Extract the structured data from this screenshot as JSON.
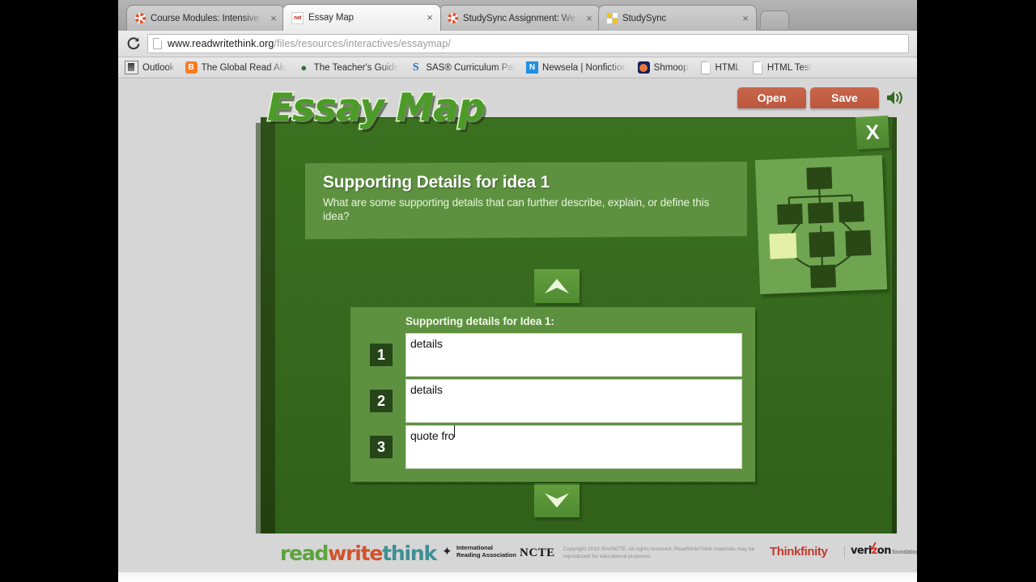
{
  "browser": {
    "tabs": [
      {
        "title": "Course Modules: Intensive",
        "favicon": "ring-icon",
        "active": false,
        "close": "×"
      },
      {
        "title": "Essay Map",
        "favicon": "rwt-icon",
        "active": true,
        "close": "×"
      },
      {
        "title": "StudySync Assignment: We",
        "favicon": "ring-icon",
        "active": false,
        "close": "×"
      },
      {
        "title": "StudySync",
        "favicon": "grid-icon",
        "active": false,
        "close": "×"
      }
    ],
    "reload_glyph": "⟳",
    "url": {
      "domain": "www.readwritethink.org",
      "path": "/files/resources/interactives/essaymap/"
    },
    "bookmarks": [
      {
        "label": "Outlook",
        "icon": "outlook-icon"
      },
      {
        "label": "The Global Read Alo",
        "icon": "blogger-icon",
        "icon_text": "B"
      },
      {
        "label": "The Teacher's Guide",
        "icon": "apple-icon",
        "icon_text": "●"
      },
      {
        "label": "SAS® Curriculum Pat",
        "icon": "sas-icon",
        "icon_text": "S"
      },
      {
        "label": "Newsela | Nonfiction",
        "icon": "newsela-icon",
        "icon_text": "N"
      },
      {
        "label": "Shmoop",
        "icon": "shmoop-icon"
      },
      {
        "label": "HTML",
        "icon": "document-icon"
      },
      {
        "label": "HTML Test",
        "icon": "document-icon"
      }
    ]
  },
  "app": {
    "title": "Essay Map",
    "open_label": "Open",
    "save_label": "Save",
    "close_label": "X",
    "banner": {
      "heading": "Supporting Details for idea 1",
      "description": "What are some supporting details that can further describe, explain, or define this idea?"
    },
    "details": {
      "label": "Supporting details for Idea 1:",
      "rows": [
        {
          "num": "1",
          "value": "details"
        },
        {
          "num": "2",
          "value": "details"
        },
        {
          "num": "3",
          "value": "quote fro"
        }
      ]
    },
    "nav": {
      "up": "▲",
      "down": "▼"
    },
    "colors": {
      "stage_dark": "#2d5118",
      "stage_inner": "#376b1e",
      "panel": "#5d9140",
      "button_red": "#bc573c",
      "highlight_node": "#e4f0a8"
    }
  },
  "footer": {
    "logo": {
      "read": "read",
      "write": "write",
      "think": "think"
    },
    "ira": {
      "line1": "International",
      "line2": "Reading Association"
    },
    "ncte": "NCTE",
    "copyright": "Copyright 2010 IRA/NCTE. All rights reserved. ReadWriteThink materials may be reproduced for educational purposes.",
    "thinkfinity": "Thinkfinity",
    "verizon": {
      "name": "verizon",
      "sub": "foundation"
    }
  }
}
